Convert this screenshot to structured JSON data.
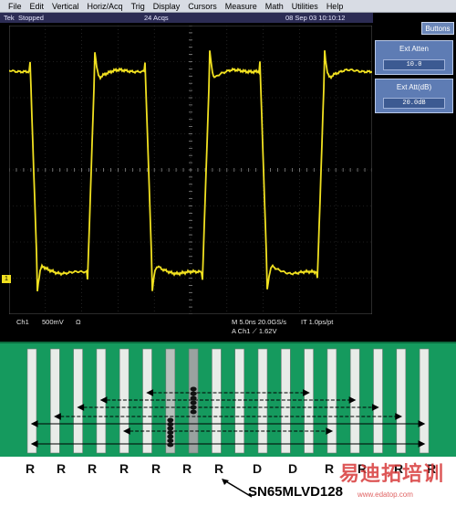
{
  "menu": [
    "File",
    "Edit",
    "Vertical",
    "Horiz/Acq",
    "Trig",
    "Display",
    "Cursors",
    "Measure",
    "Math",
    "Utilities",
    "Help"
  ],
  "status": {
    "brand": "Tek",
    "state": "Stopped",
    "acqs": "24 Acqs",
    "datetime": "08 Sep 03 10:10:12"
  },
  "buttons_label": "Buttons",
  "ext_atten": {
    "label": "Ext Atten",
    "value": "10.0"
  },
  "ext_att_db": {
    "label": "Ext Att(dB)",
    "value": "20.0dB"
  },
  "readout": {
    "channel": "Ch1",
    "scale": "500mV",
    "coupling": "Ω",
    "timebase": "M 5.0ns 20.0GS/s",
    "record": "IT 1.0ps/pt",
    "trigger": "A  Ch1  ⟋  1.62V"
  },
  "channel_marker": "1",
  "trace_color": "#f0e020",
  "board": {
    "background": "#159a5e",
    "pins": 18
  },
  "pin_labels": [
    "R",
    "R",
    "R",
    "R",
    "R",
    "R",
    "R",
    "D",
    "D",
    "R",
    "R",
    "R",
    "R"
  ],
  "chip_name": "SN65MLVD128",
  "watermark": "易迪拓培训",
  "watermark_url": "www.edatop.com"
}
